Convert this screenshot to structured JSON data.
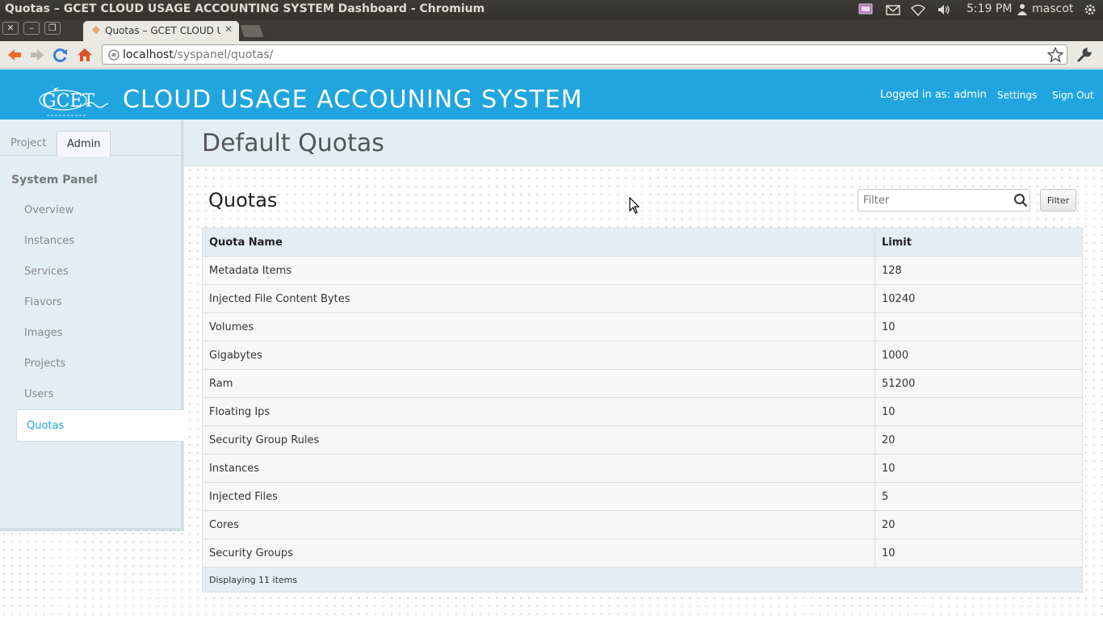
{
  "os": {
    "window_title": "Quotas – GCET CLOUD USAGE ACCOUNTING SYSTEM Dashboard - Chromium",
    "time": "5:19 PM",
    "user": "mascot"
  },
  "browser": {
    "tab_title": "Quotas – GCET CLOUD USA",
    "url_host": "localhost",
    "url_path": "/syspanel/quotas/"
  },
  "header": {
    "logo_text": "GCET",
    "brand": "CLOUD USAGE ACCOUNING SYSTEM",
    "logged_in": "Logged in as: admin",
    "settings": "Settings",
    "sign_out": "Sign Out"
  },
  "sidebar": {
    "tabs": [
      "Project",
      "Admin"
    ],
    "panel_title": "System Panel",
    "items": [
      "Overview",
      "Instances",
      "Services",
      "Flavors",
      "Images",
      "Projects",
      "Users",
      "Quotas"
    ]
  },
  "main": {
    "page_title": "Default Quotas",
    "table_title": "Quotas",
    "filter_placeholder": "Filter",
    "filter_button": "Filter",
    "columns": [
      "Quota Name",
      "Limit"
    ],
    "rows": [
      [
        "Metadata Items",
        "128"
      ],
      [
        "Injected File Content Bytes",
        "10240"
      ],
      [
        "Volumes",
        "10"
      ],
      [
        "Gigabytes",
        "1000"
      ],
      [
        "Ram",
        "51200"
      ],
      [
        "Floating Ips",
        "10"
      ],
      [
        "Security Group Rules",
        "20"
      ],
      [
        "Instances",
        "10"
      ],
      [
        "Injected Files",
        "5"
      ],
      [
        "Cores",
        "20"
      ],
      [
        "Security Groups",
        "10"
      ]
    ],
    "footer": "Displaying 11 items"
  }
}
